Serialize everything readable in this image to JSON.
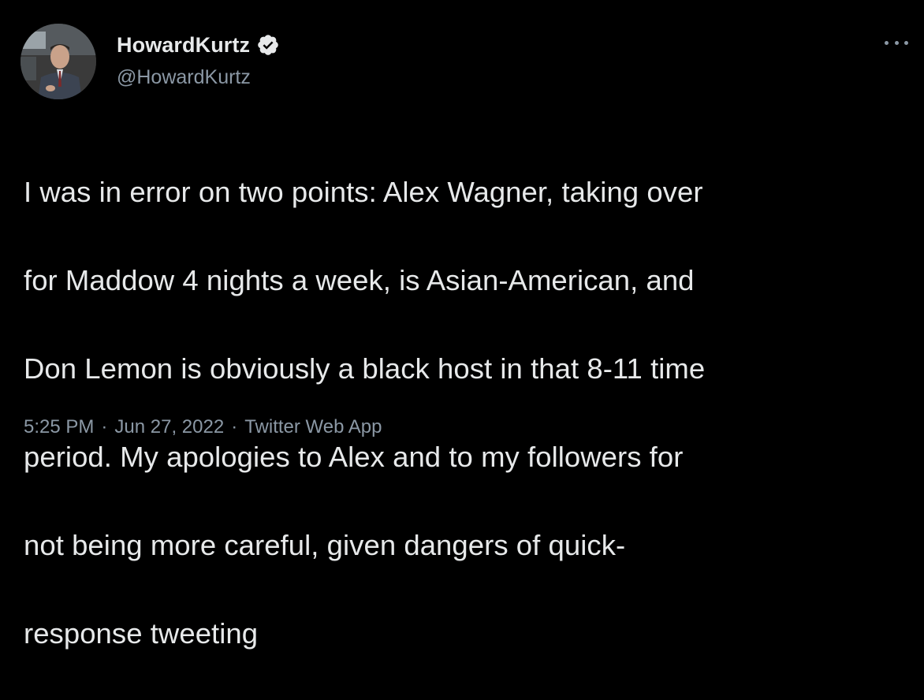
{
  "tweet": {
    "display_name": "HowardKurtz",
    "handle": "@HowardKurtz",
    "verified": true,
    "text_lines": [
      "I was in error on two points: Alex Wagner, taking over",
      "for Maddow 4 nights a week, is Asian-American, and",
      "Don Lemon is obviously a black host in that 8-11 time",
      "period. My apologies to Alex and to my followers for",
      "not being more careful, given dangers of quick-",
      "response tweeting"
    ],
    "time": "5:25 PM",
    "separator": "·",
    "date": "Jun 27, 2022",
    "source": "Twitter Web App"
  },
  "icons": {
    "verified": "verified-badge-icon",
    "more": "more-options-icon"
  },
  "colors": {
    "background": "#000000",
    "text": "#e7e9ea",
    "secondary_text": "#8b98a5",
    "verified_badge": "#e7e9ea"
  }
}
